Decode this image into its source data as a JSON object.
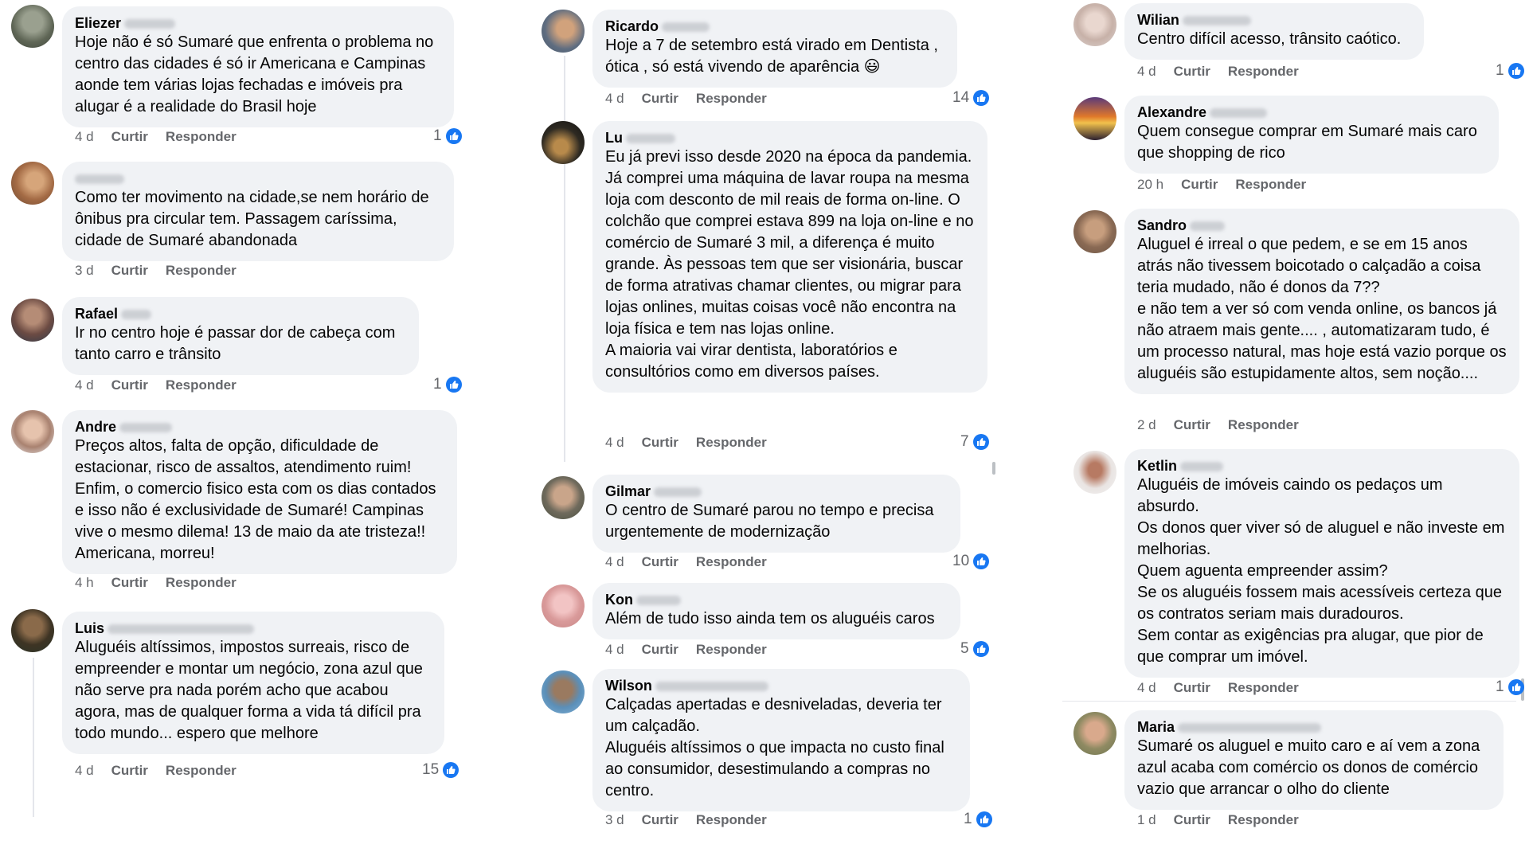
{
  "actions": {
    "like": "Curtir",
    "reply": "Responder"
  },
  "columns": [
    {
      "comments": [
        {
          "author": "Eliezer",
          "text": "Hoje não é só Sumaré que enfrenta o problema no centro das cidades é só ir Americana e Campinas aonde tem várias lojas fechadas e imóveis pra alugar é a realidade do Brasil hoje",
          "time": "4 d",
          "reactions": "1"
        },
        {
          "author": "",
          "text": "Como ter movimento na cidade,se nem horário de ônibus pra circular tem. Passagem caríssima, cidade de Sumaré abandonada",
          "time": "3 d",
          "reactions": ""
        },
        {
          "author": "Rafael",
          "text": "Ir no centro hoje é passar dor de cabeça com tanto carro e trânsito",
          "time": "4 d",
          "reactions": "1"
        },
        {
          "author": "Andre",
          "text": "Preços altos, falta de opção, dificuldade de estacionar, risco de assaltos, atendimento ruim! Enfim, o comercio fisico esta com os dias contados e isso não é exclusividade de Sumaré! Campinas vive o mesmo dilema! 13 de maio da ate tristeza!! Americana, morreu!",
          "time": "4 h",
          "reactions": ""
        },
        {
          "author": "Luis",
          "text": "Aluguéis altíssimos, impostos surreais, risco de empreender e montar um negócio, zona azul que não serve pra nada porém acho que acabou agora, mas de qualquer forma a vida tá difícil pra todo mundo... espero que melhore",
          "time": "4 d",
          "reactions": "15"
        }
      ]
    },
    {
      "comments": [
        {
          "author": "Ricardo",
          "text": "Hoje a 7 de setembro está virado em Dentista , ótica , só está vivendo de aparência 😃",
          "time": "4 d",
          "reactions": "14"
        },
        {
          "author": "Lu",
          "text": "Eu já previ isso desde 2020 na época da pandemia.\nJá comprei uma máquina de lavar roupa na mesma loja com desconto de mil reais de forma on-line. O colchão que comprei estava 899 na loja on-line e no comércio de Sumaré 3 mil, a diferença é muito grande. Às pessoas tem que ser visionária, buscar de forma atrativas chamar clientes, ou migrar para lojas onlines, muitas coisas você não encontra na loja física e tem nas lojas online.\nA maioria vai virar dentista, laboratórios e consultórios como em diversos países.",
          "time": "4 d",
          "reactions": "7"
        },
        {
          "author": "Gilmar",
          "text": "O centro de Sumaré parou no tempo e precisa urgentemente de modernização",
          "time": "4 d",
          "reactions": "10"
        },
        {
          "author": "Kon",
          "text": "Além de tudo isso ainda tem os aluguéis caros",
          "time": "4 d",
          "reactions": "5"
        },
        {
          "author": "Wilson",
          "text": "Calçadas apertadas e desniveladas, deveria ter um calçadão.\nAluguéis altíssimos o que impacta no custo final ao consumidor, desestimulando a compras no centro.",
          "time": "3 d",
          "reactions": "1"
        }
      ]
    },
    {
      "comments": [
        {
          "author": "Wilian",
          "text": "Centro difícil acesso, trânsito caótico.",
          "time": "4 d",
          "reactions": "1"
        },
        {
          "author": "Alexandre",
          "text": "Quem consegue comprar em Sumaré mais caro que shopping de rico",
          "time": "20 h",
          "reactions": ""
        },
        {
          "author": "Sandro",
          "text": "Aluguel é irreal o que pedem, e se em 15 anos atrás não tivessem boicotado o calçadão a coisa teria mudado, não é donos da 7??\n e não tem a ver só com venda online, os bancos já não atraem mais gente.... , automatizaram tudo, é um processo natural, mas hoje está vazio porque os aluguéis são estupidamente altos, sem noção....",
          "time": "2 d",
          "reactions": ""
        },
        {
          "author": "Ketlin",
          "text": "Aluguéis de imóveis caindo os pedaços um absurdo.\nOs donos quer viver só de aluguel e não investe em melhorias.\nQuem aguenta empreender assim?\nSe os aluguéis fossem mais acessíveis certeza que os contratos seriam mais duradouros.\nSem contar as exigências pra alugar, que pior de que comprar um imóvel.",
          "time": "4 d",
          "reactions": "1"
        },
        {
          "author": "Maria",
          "text": "Sumaré os aluguel e muito caro e aí vem a zona azul acaba com comércio os donos de comércio vazio que arrancar o olho  do cliente",
          "time": "1 d",
          "reactions": ""
        }
      ]
    }
  ],
  "colors": {
    "bubble": "#f0f2f5",
    "like": "#1877f2",
    "meta": "#65676b"
  }
}
